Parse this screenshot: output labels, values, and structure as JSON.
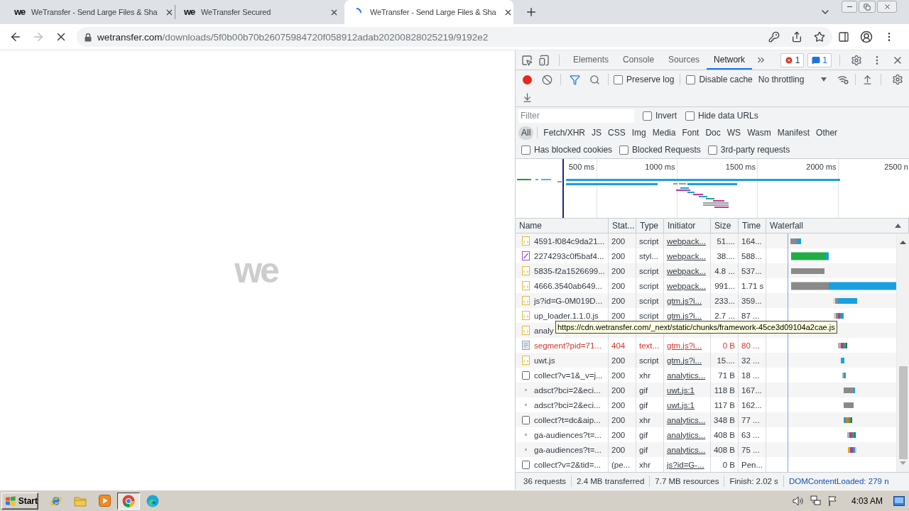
{
  "browser": {
    "tabs": [
      {
        "favicon": "we",
        "title": "WeTransfer - Send Large Files & Sha",
        "selected": false,
        "loading": false
      },
      {
        "favicon": "we",
        "title": "WeTransfer Secured",
        "selected": false,
        "loading": false
      },
      {
        "title": "WeTransfer - Send Large Files & Sha",
        "selected": true,
        "loading": true
      }
    ],
    "nav": {
      "forward_disabled": true
    },
    "address": {
      "host": "wetransfer.com",
      "path": "/downloads/5f0b00b70b26075984720f058912adab20200828025219/9192e2"
    }
  },
  "page": {
    "logo": "we"
  },
  "devtools": {
    "tabs": [
      {
        "label": "Elements",
        "selected": false
      },
      {
        "label": "Console",
        "selected": false
      },
      {
        "label": "Sources",
        "selected": false
      },
      {
        "label": "Network",
        "selected": true
      }
    ],
    "errors": "1",
    "messages": "1",
    "toolbar": {
      "recording": true,
      "preserve_log": {
        "label": "Preserve log",
        "checked": false
      },
      "disable_cache": {
        "label": "Disable cache",
        "checked": false
      },
      "throttling": "No throttling"
    },
    "filter": {
      "placeholder": "Filter",
      "options": [
        {
          "label": "Invert",
          "checked": false
        },
        {
          "label": "Hide data URLs",
          "checked": false
        }
      ]
    },
    "type_filters": [
      {
        "label": "All",
        "selected": true
      },
      {
        "label": "Fetch/XHR",
        "selected": false
      },
      {
        "label": "JS",
        "selected": false
      },
      {
        "label": "CSS",
        "selected": false
      },
      {
        "label": "Img",
        "selected": false
      },
      {
        "label": "Media",
        "selected": false
      },
      {
        "label": "Font",
        "selected": false
      },
      {
        "label": "Doc",
        "selected": false
      },
      {
        "label": "WS",
        "selected": false
      },
      {
        "label": "Wasm",
        "selected": false
      },
      {
        "label": "Manifest",
        "selected": false
      },
      {
        "label": "Other",
        "selected": false
      }
    ],
    "request_filters": [
      {
        "label": "Has blocked cookies",
        "checked": false
      },
      {
        "label": "Blocked Requests",
        "checked": false
      },
      {
        "label": "3rd-party requests",
        "checked": false
      }
    ],
    "overview": {
      "ticks": [
        "500 ms",
        "1000 ms",
        "1500 ms",
        "2000 ms",
        "2500 n"
      ]
    },
    "table": {
      "columns": [
        "Name",
        "Stat...",
        "Type",
        "Initiator",
        "Size",
        "Time",
        "Waterfall"
      ],
      "rows": [
        {
          "kind": "script",
          "name": "4591-f084c9da21...",
          "status": "200",
          "type": "script",
          "initiator": "webpack...",
          "size": "51....",
          "time": "164...",
          "error": false
        },
        {
          "kind": "stylesheet",
          "name": "2274293c0f5baf4...",
          "status": "200",
          "type": "styl...",
          "initiator": "webpack...",
          "size": "38....",
          "time": "588...",
          "error": false
        },
        {
          "kind": "script",
          "name": "5835-f2a1526699...",
          "status": "200",
          "type": "script",
          "initiator": "webpack...",
          "size": "4.8 ...",
          "time": "537...",
          "error": false
        },
        {
          "kind": "script",
          "name": "4666.3540ab649...",
          "status": "200",
          "type": "script",
          "initiator": "webpack...",
          "size": "991...",
          "time": "1.71 s",
          "error": false
        },
        {
          "kind": "script",
          "name": "js?id=G-0M019D...",
          "status": "200",
          "type": "script",
          "initiator": "gtm.js?i...",
          "size": "233...",
          "time": "359...",
          "error": false
        },
        {
          "kind": "script",
          "name": "up_loader.1.1.0.js",
          "status": "200",
          "type": "script",
          "initiator": "gtm.js?i...",
          "size": "2.7 ...",
          "time": "87 ...",
          "error": false
        },
        {
          "kind": "script",
          "name": "analy",
          "error": false
        },
        {
          "kind": "text",
          "name": "segment?pid=71...",
          "status": "404",
          "type": "text...",
          "initiator": "gtm.js?i...",
          "size": "0 B",
          "time": "80 ...",
          "error": true
        },
        {
          "kind": "script",
          "name": "uwt.js",
          "status": "200",
          "type": "script",
          "initiator": "gtm.js?i...",
          "size": "15....",
          "time": "32 ...",
          "error": false
        },
        {
          "kind": "xhr",
          "name": "collect?v=1&_v=j...",
          "status": "200",
          "type": "xhr",
          "initiator": "analytics...",
          "size": "71 B",
          "time": "18 ...",
          "error": false
        },
        {
          "kind": "image",
          "name": "adsct?bci=2&eci...",
          "status": "200",
          "type": "gif",
          "initiator": "uwt.js:1",
          "size": "118 B",
          "time": "167...",
          "error": false
        },
        {
          "kind": "image",
          "name": "adsct?bci=2&eci...",
          "status": "200",
          "type": "gif",
          "initiator": "uwt.js:1",
          "size": "117 B",
          "time": "162...",
          "error": false
        },
        {
          "kind": "xhr",
          "name": "collect?t=dc&aip...",
          "status": "200",
          "type": "xhr",
          "initiator": "analytics...",
          "size": "348 B",
          "time": "77 ...",
          "error": false
        },
        {
          "kind": "image",
          "name": "ga-audiences?t=...",
          "status": "200",
          "type": "gif",
          "initiator": "analytics...",
          "size": "408 B",
          "time": "63 ...",
          "error": false
        },
        {
          "kind": "image",
          "name": "ga-audiences?t=...",
          "status": "200",
          "type": "gif",
          "initiator": "analytics...",
          "size": "408 B",
          "time": "75 ...",
          "error": false
        },
        {
          "kind": "xhr",
          "name": "collect?v=2&tid=...",
          "status": "(pe...",
          "type": "xhr",
          "initiator": "js?id=G-...",
          "size": "0 B",
          "time": "Pen...",
          "error": false
        }
      ]
    },
    "tooltip": "https://cdn.wetransfer.com/_next/static/chunks/framework-45ce3d09104a2cae.js",
    "status_bar": {
      "items": [
        "36 requests",
        "2.4 MB transferred",
        "7.7 MB resources",
        "Finish: 2.02 s"
      ],
      "dom_content_loaded": "DOMContentLoaded: 279 n"
    }
  },
  "taskbar": {
    "start": "Start",
    "clock": "4:03 AM"
  }
}
